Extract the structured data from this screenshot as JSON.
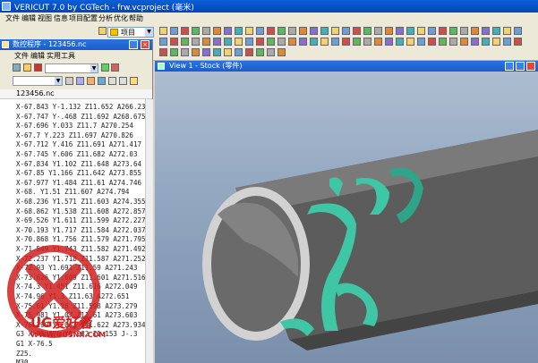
{
  "window": {
    "title": "VERICUT 7.0 by CGTech - frw.vcproject (毫米)"
  },
  "menubar": {
    "items": [
      "文件",
      "编辑",
      "视图",
      "信息",
      "项目",
      "配置",
      "分析",
      "优化",
      "帮助"
    ]
  },
  "toolbar": {
    "project_label": "项目"
  },
  "nc_panel": {
    "title": "数控程序 - 123456.nc",
    "menu": [
      "文件",
      "编辑",
      "实用工具"
    ],
    "file_label": "123456.nc",
    "lines": [
      "X-67.843 Y-1.132 Z11.652 A266.23",
      "X-67.747 Y-.468 Z11.692 A268.675",
      "X-67.696 Y.033 Z11.7 A270.254",
      "X-67.7 Y.223 Z11.697 A270.826",
      "X-67.712 Y.416 Z11.691 A271.417",
      "X-67.745 Y.606 Z11.682 A272.03",
      "X-67.834 Y1.102 Z11.648 A273.64",
      "X-67.85 Y1.166 Z11.642 A273.855",
      "X-67.977 Y1.484 Z11.61 A274.746",
      "X-68. Y1.51 Z11.607 A274.794",
      "X-68.236 Y1.571 Z11.603 A274.355",
      "X-68.862 Y1.538 Z11.608 A272.857",
      "X-69.526 Y1.611 Z11.599 A272.227",
      "X-70.193 Y1.717 Z11.584 A272.037",
      "X-70.868 Y1.756 Z11.579 A271.795",
      "X-71.549 Y1.743 Z11.582 A271.492",
      "X-72.237 Y1.718 Z11.587 A271.252",
      "X-72.93 Y1.691 Z11.59 A271.243",
      "X-73.626 Y1.609 Z11.601 A271.516",
      "X-74.3 Y1.451 Z11.616 A272.049",
      "X-74.96 Y1.3 Z11.63 A272.651",
      "X-75.61 Y1.16 Z11.598 A273.279",
      "X-75.981 Y1.07 Z11.61 A273.603",
      "X-76.299 Y1.033 Z11.622 A273.934",
      "G3 X-76.476 Y1.082 I1.153 J-.3",
      "G1 X-76.5",
      "Z25.",
      "M30",
      "M30"
    ]
  },
  "view": {
    "title": "View 1 - Stock (零件)"
  },
  "watermark": {
    "brand": "UG爱好者",
    "url": "WWW.UGSNX.COM"
  },
  "colors": {
    "titlebar": "#0a5fd8",
    "part": "#5a5a5a",
    "cut": "#3fc6a4",
    "background": "#9aaec6"
  }
}
